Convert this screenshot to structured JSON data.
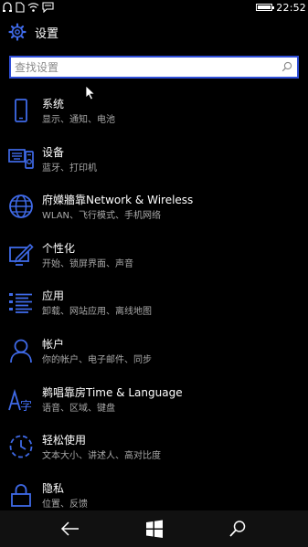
{
  "status": {
    "time": "22:52",
    "battery_level": 0.95
  },
  "header": {
    "title": "设置",
    "icon": "gear-icon"
  },
  "search": {
    "placeholder": "查找设置",
    "icon": "search-icon"
  },
  "items": [
    {
      "name": "系统",
      "sub": "显示、通知、电池",
      "icon": "phone-icon"
    },
    {
      "name": "设备",
      "sub": "蓝牙、打印机",
      "icon": "devices-icon"
    },
    {
      "name": "府嬫牆靠Network & Wireless",
      "sub": "WLAN、飞行模式、手机网络",
      "icon": "globe-icon"
    },
    {
      "name": "个性化",
      "sub": "开始、锁屏界面、声音",
      "icon": "personalize-icon"
    },
    {
      "name": "应用",
      "sub": "卸载、网站应用、离线地图",
      "icon": "apps-icon"
    },
    {
      "name": "帐户",
      "sub": "你的帐户、电子邮件、同步",
      "icon": "person-icon"
    },
    {
      "name": "鹈唱靠房Time & Language",
      "sub": "语音、区域、键盘",
      "icon": "time-language-icon"
    },
    {
      "name": "轻松使用",
      "sub": "文本大小、讲述人、高对比度",
      "icon": "ease-of-access-icon"
    },
    {
      "name": "隐私",
      "sub": "位置、反馈",
      "icon": "lock-icon"
    }
  ],
  "colors": {
    "accent": "#2f4ed8",
    "icon": "#3f6ae8",
    "subtext": "#a8a8a8"
  }
}
